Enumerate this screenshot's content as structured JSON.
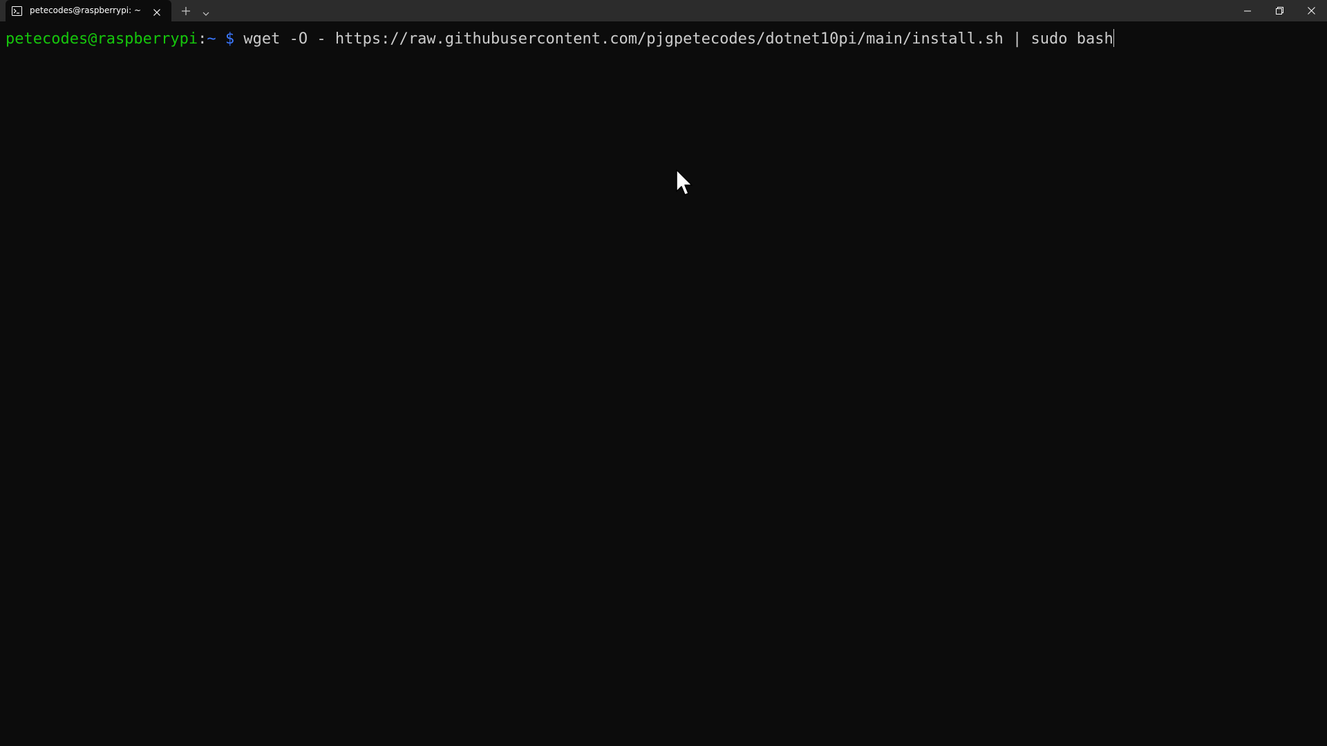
{
  "tab": {
    "title": "petecodes@raspberrypi: ~",
    "icon": "terminal-icon"
  },
  "window_controls": {
    "minimize_icon": "minimize-icon",
    "maximize_icon": "restore-icon",
    "close_icon": "close-icon"
  },
  "terminal": {
    "prompt_user": "petecodes@raspberrypi",
    "prompt_colon": ":",
    "prompt_path": "~",
    "prompt_symbol": "$",
    "command": "wget -O - https://raw.githubusercontent.com/pjgpetecodes/dotnet10pi/main/install.sh | sudo bash"
  },
  "colors": {
    "background": "#0c0c0c",
    "titlebar": "#2c2c2c",
    "prompt_user": "#16c60c",
    "prompt_path": "#3b78ff",
    "text": "#cccccc"
  }
}
